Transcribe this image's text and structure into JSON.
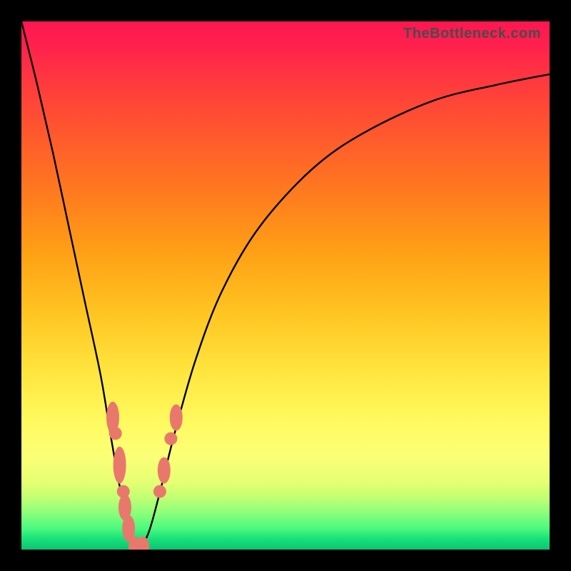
{
  "watermark": "TheBottleneck.com",
  "chart_data": {
    "type": "line",
    "title": "",
    "xlabel": "",
    "ylabel": "",
    "xlim": [
      0,
      100
    ],
    "ylim": [
      0,
      100
    ],
    "grid": false,
    "legend": false,
    "background": "vertical-gradient green→yellow→red",
    "series": [
      {
        "name": "bottleneck-curve",
        "description": "V-shaped black curve; minimum (0) near x≈22, rising steeply toward 100 on left edge and asymptotically toward ~90 on right edge.",
        "x": [
          0,
          3,
          6,
          9,
          12,
          15,
          17,
          19,
          21,
          22,
          24,
          26,
          29,
          33,
          38,
          45,
          55,
          65,
          78,
          90,
          100
        ],
        "y": [
          100,
          88,
          75,
          61,
          47,
          33,
          21,
          10,
          2,
          0,
          3,
          10,
          22,
          36,
          49,
          61,
          72,
          79,
          85,
          88,
          90
        ]
      }
    ],
    "markers": {
      "description": "pink rounded markers clustered on both arms of the V near the bottom",
      "points": [
        {
          "x": 17.3,
          "y": 25,
          "shape": "oval",
          "h": 6
        },
        {
          "x": 17.8,
          "y": 22,
          "shape": "circle"
        },
        {
          "x": 18.6,
          "y": 16,
          "shape": "oval",
          "h": 7
        },
        {
          "x": 19.3,
          "y": 11,
          "shape": "circle"
        },
        {
          "x": 19.6,
          "y": 8,
          "shape": "oval",
          "h": 5
        },
        {
          "x": 20.3,
          "y": 4,
          "shape": "oval",
          "h": 5
        },
        {
          "x": 21.5,
          "y": 0.5,
          "shape": "oval",
          "h": 4
        },
        {
          "x": 23.0,
          "y": 0.5,
          "shape": "oval",
          "h": 4
        },
        {
          "x": 26.2,
          "y": 11,
          "shape": "circle"
        },
        {
          "x": 27.0,
          "y": 15,
          "shape": "oval",
          "h": 5
        },
        {
          "x": 28.3,
          "y": 21,
          "shape": "circle"
        },
        {
          "x": 29.3,
          "y": 25,
          "shape": "oval",
          "h": 5
        }
      ]
    },
    "colors": {
      "curve": "#000000",
      "markers": "#e9786c",
      "gradient_top": "#ff1651",
      "gradient_mid": "#ffe43d",
      "gradient_bottom": "#0fc173",
      "frame": "#000000"
    }
  }
}
